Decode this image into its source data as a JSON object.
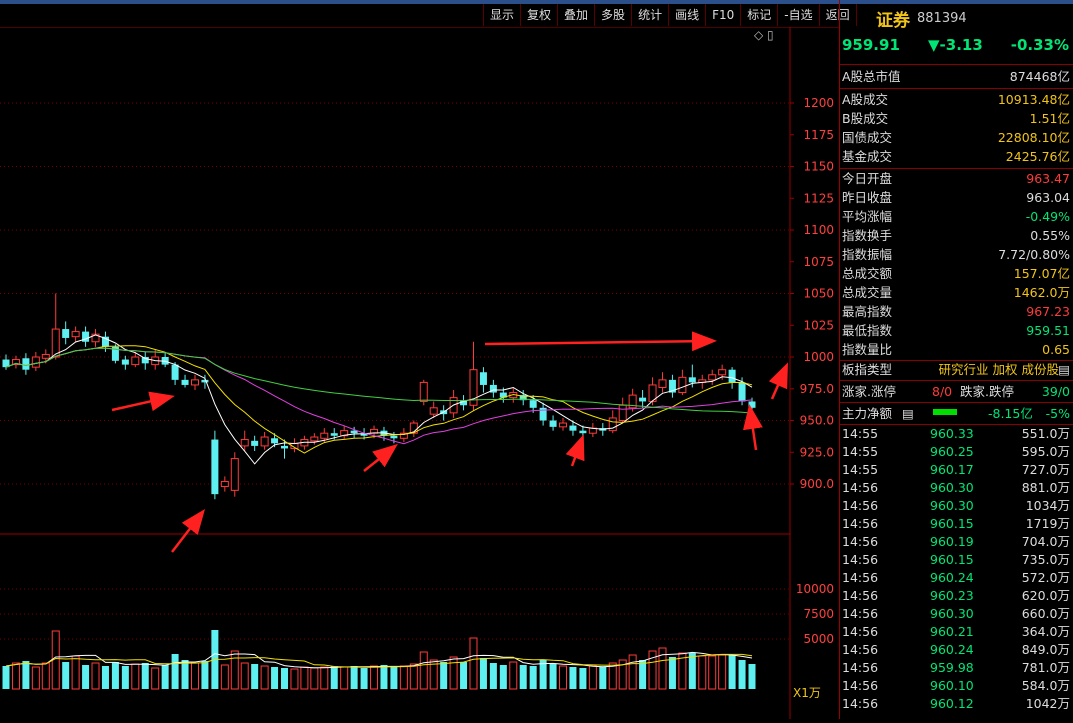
{
  "toolbar": [
    "显示",
    "复权",
    "叠加",
    "多股",
    "统计",
    "画线",
    "F10",
    "标记",
    "-自选",
    "返回"
  ],
  "kline": {
    "y_axis": [
      "1200",
      "1175",
      "1150",
      "1125",
      "1100",
      "1075",
      "1050",
      "1025",
      "1000",
      "975.0",
      "950.0",
      "925.0",
      "900.0"
    ],
    "vol_axis": [
      "10000",
      "7500",
      "5000"
    ],
    "vol_unit": "X1万",
    "chart_data": {
      "type": "candlestick",
      "ylim": [
        880,
        1220
      ],
      "candles": [
        {
          "o": 998,
          "c": 992,
          "h": 1002,
          "l": 990
        },
        {
          "o": 994,
          "c": 998,
          "h": 1001,
          "l": 991
        },
        {
          "o": 999,
          "c": 990,
          "h": 1003,
          "l": 986
        },
        {
          "o": 992,
          "c": 1000,
          "h": 1004,
          "l": 989
        },
        {
          "o": 999,
          "c": 1002,
          "h": 1006,
          "l": 995
        },
        {
          "o": 1000,
          "c": 1022,
          "h": 1050,
          "l": 998
        },
        {
          "o": 1022,
          "c": 1015,
          "h": 1028,
          "l": 1010
        },
        {
          "o": 1016,
          "c": 1020,
          "h": 1024,
          "l": 1012
        },
        {
          "o": 1020,
          "c": 1012,
          "h": 1024,
          "l": 1008
        },
        {
          "o": 1012,
          "c": 1018,
          "h": 1022,
          "l": 1008
        },
        {
          "o": 1016,
          "c": 1008,
          "h": 1020,
          "l": 1004
        },
        {
          "o": 1008,
          "c": 997,
          "h": 1010,
          "l": 995
        },
        {
          "o": 998,
          "c": 994,
          "h": 1001,
          "l": 990
        },
        {
          "o": 994,
          "c": 1000,
          "h": 1004,
          "l": 992
        },
        {
          "o": 1000,
          "c": 995,
          "h": 1004,
          "l": 990
        },
        {
          "o": 994,
          "c": 1000,
          "h": 1006,
          "l": 990
        },
        {
          "o": 1000,
          "c": 994,
          "h": 1003,
          "l": 992
        },
        {
          "o": 994,
          "c": 982,
          "h": 996,
          "l": 978
        },
        {
          "o": 982,
          "c": 978,
          "h": 986,
          "l": 976
        },
        {
          "o": 978,
          "c": 982,
          "h": 986,
          "l": 974
        },
        {
          "o": 982,
          "c": 980,
          "h": 986,
          "l": 975
        },
        {
          "o": 935,
          "c": 892,
          "h": 942,
          "l": 888
        },
        {
          "o": 898,
          "c": 902,
          "h": 906,
          "l": 894
        },
        {
          "o": 895,
          "c": 920,
          "h": 925,
          "l": 890
        },
        {
          "o": 930,
          "c": 935,
          "h": 942,
          "l": 926
        },
        {
          "o": 934,
          "c": 930,
          "h": 938,
          "l": 926
        },
        {
          "o": 930,
          "c": 937,
          "h": 941,
          "l": 927
        },
        {
          "o": 936,
          "c": 932,
          "h": 940,
          "l": 929
        },
        {
          "o": 930,
          "c": 928,
          "h": 935,
          "l": 920
        },
        {
          "o": 928,
          "c": 932,
          "h": 936,
          "l": 925
        },
        {
          "o": 930,
          "c": 935,
          "h": 938,
          "l": 927
        },
        {
          "o": 934,
          "c": 937,
          "h": 940,
          "l": 931
        },
        {
          "o": 936,
          "c": 940,
          "h": 944,
          "l": 933
        },
        {
          "o": 940,
          "c": 938,
          "h": 944,
          "l": 935
        },
        {
          "o": 938,
          "c": 942,
          "h": 946,
          "l": 935
        },
        {
          "o": 942,
          "c": 940,
          "h": 945,
          "l": 936
        },
        {
          "o": 940,
          "c": 938,
          "h": 944,
          "l": 935
        },
        {
          "o": 940,
          "c": 943,
          "h": 946,
          "l": 936
        },
        {
          "o": 942,
          "c": 938,
          "h": 945,
          "l": 934
        },
        {
          "o": 938,
          "c": 936,
          "h": 941,
          "l": 932
        },
        {
          "o": 936,
          "c": 940,
          "h": 944,
          "l": 933
        },
        {
          "o": 940,
          "c": 948,
          "h": 950,
          "l": 937
        },
        {
          "o": 965,
          "c": 980,
          "h": 982,
          "l": 962
        },
        {
          "o": 955,
          "c": 960,
          "h": 965,
          "l": 952
        },
        {
          "o": 958,
          "c": 955,
          "h": 962,
          "l": 950
        },
        {
          "o": 956,
          "c": 968,
          "h": 974,
          "l": 952
        },
        {
          "o": 966,
          "c": 962,
          "h": 970,
          "l": 958
        },
        {
          "o": 962,
          "c": 990,
          "h": 1012,
          "l": 958
        },
        {
          "o": 988,
          "c": 978,
          "h": 992,
          "l": 972
        },
        {
          "o": 978,
          "c": 972,
          "h": 982,
          "l": 968
        },
        {
          "o": 972,
          "c": 968,
          "h": 976,
          "l": 964
        },
        {
          "o": 968,
          "c": 972,
          "h": 976,
          "l": 964
        },
        {
          "o": 970,
          "c": 966,
          "h": 974,
          "l": 962
        },
        {
          "o": 966,
          "c": 960,
          "h": 970,
          "l": 956
        },
        {
          "o": 960,
          "c": 950,
          "h": 964,
          "l": 946
        },
        {
          "o": 950,
          "c": 945,
          "h": 954,
          "l": 942
        },
        {
          "o": 945,
          "c": 948,
          "h": 952,
          "l": 942
        },
        {
          "o": 946,
          "c": 942,
          "h": 950,
          "l": 938
        },
        {
          "o": 942,
          "c": 940,
          "h": 946,
          "l": 937
        },
        {
          "o": 940,
          "c": 944,
          "h": 948,
          "l": 937
        },
        {
          "o": 944,
          "c": 942,
          "h": 948,
          "l": 938
        },
        {
          "o": 942,
          "c": 952,
          "h": 958,
          "l": 940
        },
        {
          "o": 950,
          "c": 962,
          "h": 968,
          "l": 948
        },
        {
          "o": 960,
          "c": 970,
          "h": 975,
          "l": 957
        },
        {
          "o": 968,
          "c": 965,
          "h": 974,
          "l": 960
        },
        {
          "o": 965,
          "c": 978,
          "h": 984,
          "l": 962
        },
        {
          "o": 976,
          "c": 982,
          "h": 988,
          "l": 972
        },
        {
          "o": 982,
          "c": 972,
          "h": 986,
          "l": 968
        },
        {
          "o": 972,
          "c": 984,
          "h": 990,
          "l": 970
        },
        {
          "o": 984,
          "c": 980,
          "h": 994,
          "l": 976
        },
        {
          "o": 980,
          "c": 982,
          "h": 986,
          "l": 975
        },
        {
          "o": 982,
          "c": 986,
          "h": 990,
          "l": 978
        },
        {
          "o": 986,
          "c": 990,
          "h": 994,
          "l": 982
        },
        {
          "o": 990,
          "c": 980,
          "h": 992,
          "l": 975
        },
        {
          "o": 980,
          "c": 965,
          "h": 984,
          "l": 962
        },
        {
          "o": 965,
          "c": 960,
          "h": 968,
          "l": 958
        }
      ],
      "volumes": [
        2300,
        2600,
        2800,
        2200,
        2600,
        5800,
        2700,
        3300,
        2400,
        2600,
        2300,
        2700,
        2300,
        2500,
        2600,
        2100,
        2400,
        3500,
        2900,
        2600,
        2800,
        5900,
        2400,
        3800,
        2600,
        2500,
        2300,
        2200,
        2100,
        2000,
        2200,
        2100,
        2200,
        2300,
        2200,
        2300,
        2100,
        2300,
        2400,
        2200,
        2300,
        2500,
        3700,
        2900,
        2700,
        3200,
        2700,
        5100,
        3100,
        2600,
        2400,
        2700,
        2400,
        2300,
        2900,
        2500,
        2300,
        2200,
        2100,
        2300,
        2200,
        2600,
        2900,
        3400,
        2900,
        3800,
        4100,
        3200,
        3600,
        3600,
        3300,
        3300,
        3400,
        3400,
        2900,
        2500
      ]
    }
  },
  "panel": {
    "name": "证券",
    "code": "881394",
    "price": "959.91",
    "change": "▼-3.13",
    "pct": "-0.33%",
    "group1": [
      {
        "k": "A股总市值",
        "v": "874468亿",
        "c": "w"
      }
    ],
    "group2": [
      {
        "k": "A股成交",
        "v": "10913.48亿",
        "c": "y"
      },
      {
        "k": "B股成交",
        "v": "1.51亿",
        "c": "y"
      },
      {
        "k": "国债成交",
        "v": "22808.10亿",
        "c": "y"
      },
      {
        "k": "基金成交",
        "v": "2425.76亿",
        "c": "y"
      }
    ],
    "group3": [
      {
        "k": "今日开盘",
        "v": "963.47",
        "c": "r"
      },
      {
        "k": "昨日收盘",
        "v": "963.04",
        "c": "w"
      },
      {
        "k": "平均涨幅",
        "v": "-0.49%",
        "c": "g"
      },
      {
        "k": "指数换手",
        "v": "0.55%",
        "c": "w"
      },
      {
        "k": "指数振幅",
        "v": "7.72/0.80%",
        "c": "w"
      },
      {
        "k": "总成交额",
        "v": "157.07亿",
        "c": "y"
      },
      {
        "k": "总成交量",
        "v": "1462.0万",
        "c": "y"
      },
      {
        "k": "最高指数",
        "v": "967.23",
        "c": "r"
      },
      {
        "k": "最低指数",
        "v": "959.51",
        "c": "g"
      },
      {
        "k": "指数量比",
        "v": "0.65",
        "c": "y"
      }
    ],
    "plate_label": "板指类型",
    "plate_value": "研究行业 加权 成份股",
    "updown_label": "涨家.涨停",
    "updown_value": "8/0",
    "down_label": "跌家.跌停",
    "down_value": "39/0",
    "flow_label": "主力净额",
    "flow_value": "-8.15亿",
    "flow_pct": "-5%",
    "ticks": [
      {
        "t": "14:55",
        "p": "960.33",
        "v": "551.0万"
      },
      {
        "t": "14:55",
        "p": "960.25",
        "v": "595.0万"
      },
      {
        "t": "14:55",
        "p": "960.17",
        "v": "727.0万"
      },
      {
        "t": "14:56",
        "p": "960.30",
        "v": "881.0万"
      },
      {
        "t": "14:56",
        "p": "960.30",
        "v": "1034万"
      },
      {
        "t": "14:56",
        "p": "960.15",
        "v": "1719万"
      },
      {
        "t": "14:56",
        "p": "960.19",
        "v": "704.0万"
      },
      {
        "t": "14:56",
        "p": "960.15",
        "v": "735.0万"
      },
      {
        "t": "14:56",
        "p": "960.24",
        "v": "572.0万"
      },
      {
        "t": "14:56",
        "p": "960.23",
        "v": "620.0万"
      },
      {
        "t": "14:56",
        "p": "960.30",
        "v": "660.0万"
      },
      {
        "t": "14:56",
        "p": "960.21",
        "v": "364.0万"
      },
      {
        "t": "14:56",
        "p": "960.24",
        "v": "849.0万"
      },
      {
        "t": "14:56",
        "p": "959.98",
        "v": "781.0万"
      },
      {
        "t": "14:56",
        "p": "960.10",
        "v": "584.0万"
      },
      {
        "t": "14:56",
        "p": "960.12",
        "v": "1042万"
      }
    ]
  }
}
